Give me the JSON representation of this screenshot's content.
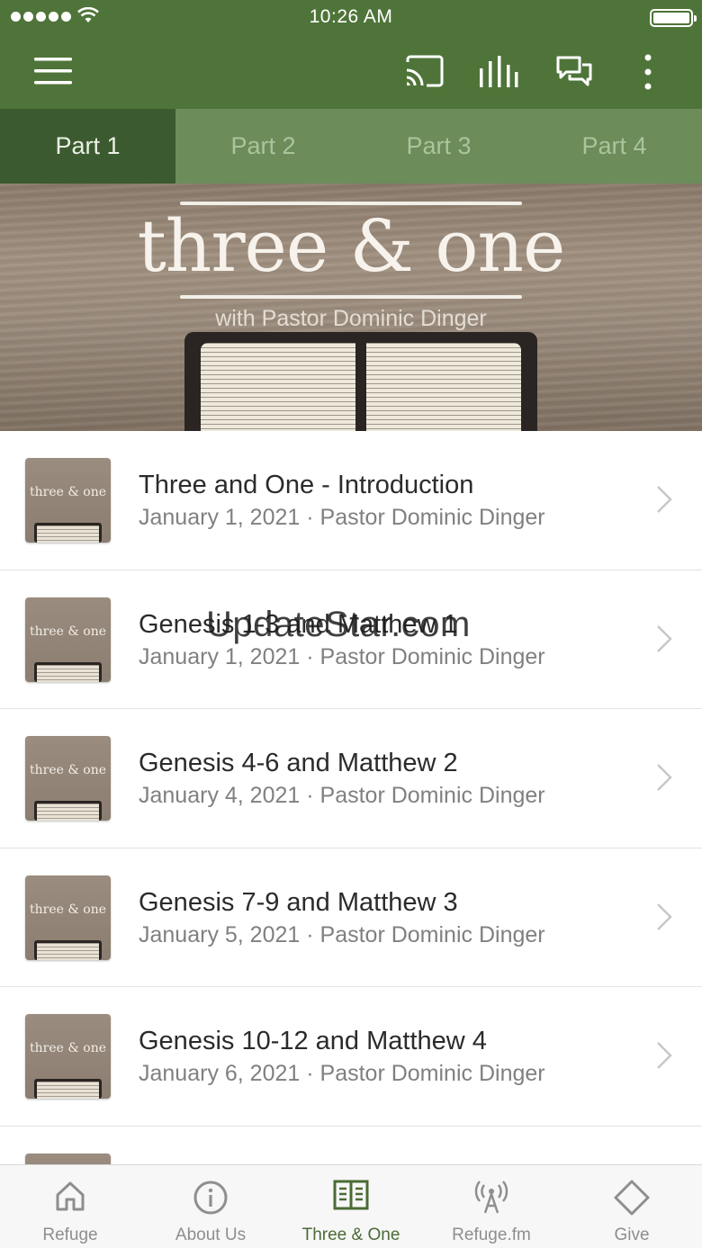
{
  "status_bar": {
    "time": "10:26 AM"
  },
  "app_bar": {
    "icons": [
      "menu-icon",
      "cast-icon",
      "audio-bars-icon",
      "chat-icon",
      "more-vertical-icon"
    ]
  },
  "tabs": [
    {
      "label": "Part 1",
      "active": true
    },
    {
      "label": "Part 2",
      "active": false
    },
    {
      "label": "Part 3",
      "active": false
    },
    {
      "label": "Part 4",
      "active": false
    }
  ],
  "hero": {
    "title": "three & one",
    "subtitle": "with Pastor Dominic Dinger"
  },
  "items": [
    {
      "thumb_text": "three & one",
      "title": "Three and One - Introduction",
      "subtitle": "January 1, 2021 · Pastor Dominic Dinger"
    },
    {
      "thumb_text": "three & one",
      "title": "Genesis 1-3 and Matthew 1",
      "subtitle": "January 1, 2021 · Pastor Dominic Dinger"
    },
    {
      "thumb_text": "three & one",
      "title": "Genesis 4-6 and Matthew 2",
      "subtitle": "January 4, 2021 · Pastor Dominic Dinger"
    },
    {
      "thumb_text": "three & one",
      "title": "Genesis 7-9 and Matthew 3",
      "subtitle": "January 5, 2021 · Pastor Dominic Dinger"
    },
    {
      "thumb_text": "three & one",
      "title": "Genesis 10-12 and Matthew 4",
      "subtitle": "January 6, 2021 · Pastor Dominic Dinger"
    }
  ],
  "watermark": "UpdateStar.com",
  "bottom_nav": [
    {
      "label": "Refuge",
      "icon": "home-icon",
      "active": false
    },
    {
      "label": "About Us",
      "icon": "info-icon",
      "active": false
    },
    {
      "label": "Three & One",
      "icon": "book-icon",
      "active": true
    },
    {
      "label": "Refuge.fm",
      "icon": "broadcast-icon",
      "active": false
    },
    {
      "label": "Give",
      "icon": "diamond-icon",
      "active": false
    }
  ],
  "colors": {
    "header_green": "#4f7439",
    "tab_active": "#3c5a2f",
    "tab_inactive": "#6c8c5a",
    "nav_active": "#4a6b35"
  }
}
